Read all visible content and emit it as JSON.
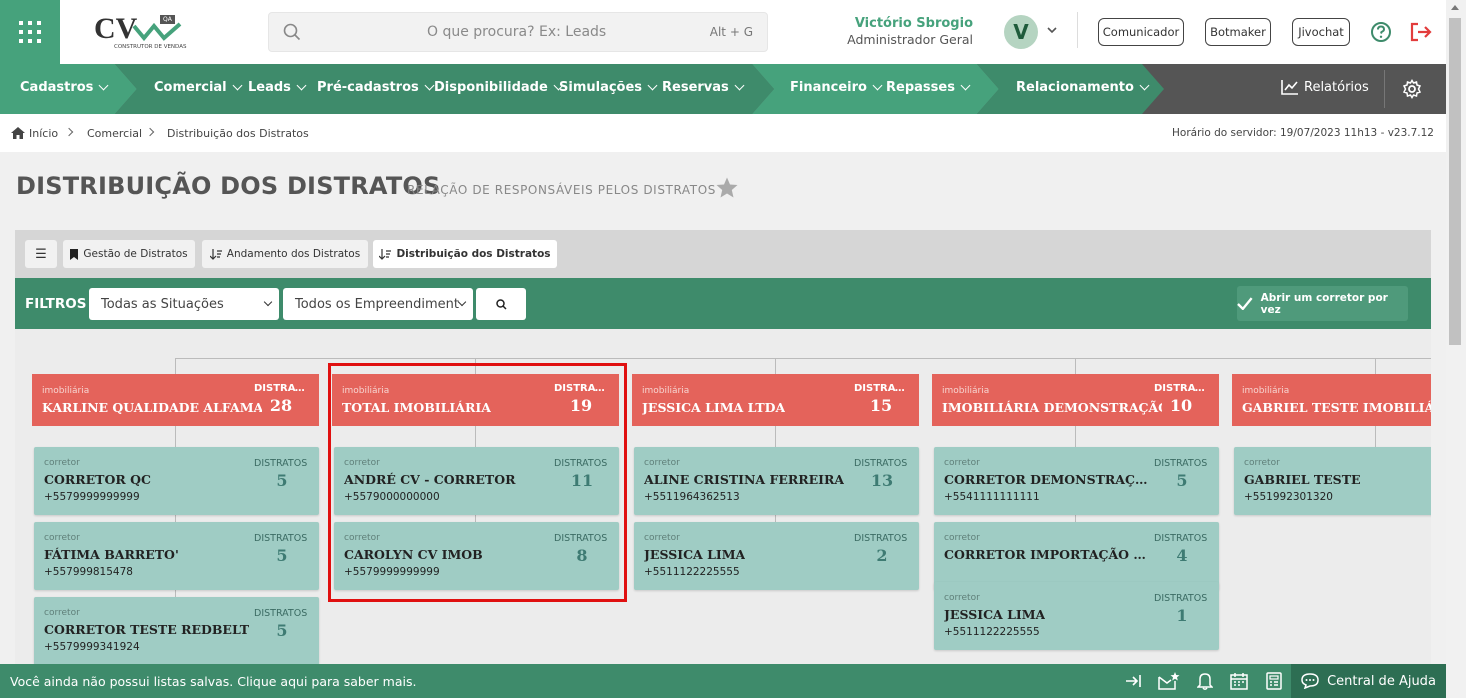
{
  "topbar": {
    "logo_text": "CV",
    "logo_badge": "QA",
    "logo_sub": "CONSTRUTOR DE VENDAS",
    "search_placeholder": "O que procura? Ex: Leads",
    "search_shortcut": "Alt + G",
    "user_name": "Victório Sbrogio",
    "user_role": "Administrador Geral",
    "avatar_initial": "V",
    "buttons": [
      "Comunicador",
      "Botmaker",
      "Jivochat"
    ]
  },
  "nav": {
    "items": [
      "Cadastros",
      "Comercial",
      "Leads",
      "Pré-cadastros",
      "Disponibilidade",
      "Simulações",
      "Reservas",
      "Financeiro",
      "Repasses",
      "Relacionamento"
    ],
    "reports": "Relatórios"
  },
  "breadcrumb": {
    "items": [
      "Início",
      "Comercial",
      "Distribuição dos Distratos"
    ],
    "server_time": "Horário do servidor: 19/07/2023 11h13 - v23.7.12"
  },
  "page": {
    "title": "DISTRIBUIÇÃO DOS DISTRATOS",
    "subtitle": "RELAÇÃO DE RESPONSÁVEIS PELOS DISTRATOS"
  },
  "tabs": {
    "menu_symbol": "☰",
    "items": [
      "Gestão de Distratos",
      "Andamento dos Distratos",
      "Distribuição dos Distratos"
    ]
  },
  "filters": {
    "label": "FILTROS",
    "situations": "Todas as Situações",
    "developments": "Todos os Empreendiment",
    "one_broker_button": "Abrir um corretor por vez"
  },
  "labels": {
    "group_kind": "imobiliária",
    "broker_kind": "corretor",
    "group_count_label": "DISTRATOS",
    "broker_count_label": "DISTRATOS"
  },
  "groups": [
    {
      "name": "KARLINE QUALIDADE ALFAMA",
      "count": "28",
      "brokers": [
        {
          "name": "CORRETOR QC",
          "phone": "+5579999999999",
          "count": "5"
        },
        {
          "name": "FÁTIMA BARRETO'",
          "phone": "+557999815478",
          "count": "5"
        },
        {
          "name": "CORRETOR TESTE REDBELT",
          "phone": "+5579999341924",
          "count": "5"
        }
      ]
    },
    {
      "name": "TOTAL IMOBILIÁRIA",
      "count": "19",
      "brokers": [
        {
          "name": "ANDRÉ CV - CORRETOR",
          "phone": "+5579000000000",
          "count": "11"
        },
        {
          "name": "CAROLYN CV IMOB",
          "phone": "+5579999999999",
          "count": "8"
        }
      ]
    },
    {
      "name": "JESSICA LIMA LTDA",
      "count": "15",
      "brokers": [
        {
          "name": "ALINE CRISTINA FERREIRA",
          "phone": "+5511964362513",
          "count": "13"
        },
        {
          "name": "JESSICA LIMA",
          "phone": "+5511122225555",
          "count": "2"
        }
      ]
    },
    {
      "name": "IMOBILIÁRIA DEMONSTRAÇÃO",
      "count": "10",
      "brokers": [
        {
          "name": "CORRETOR DEMONSTRAÇÃO",
          "phone": "+5541111111111",
          "count": "5"
        },
        {
          "name": "CORRETOR IMPORTAÇÃO RES...",
          "phone": "",
          "count": "4"
        },
        {
          "name": "JESSICA LIMA",
          "phone": "+5511122225555",
          "count": "1"
        }
      ]
    },
    {
      "name": "GABRIEL TESTE IMOBILIÁ",
      "count": "",
      "brokers": [
        {
          "name": "GABRIEL TESTE",
          "phone": "+551992301320",
          "count": ""
        }
      ]
    }
  ],
  "bottombar": {
    "message": "Você ainda não possui listas salvas. Clique aqui para saber mais.",
    "help_center": "Central de Ajuda"
  },
  "colors": {
    "brand_green": "#46a27c",
    "group_red": "#e4635b",
    "broker_teal": "#9fccc4",
    "highlight_red": "#e01010"
  }
}
